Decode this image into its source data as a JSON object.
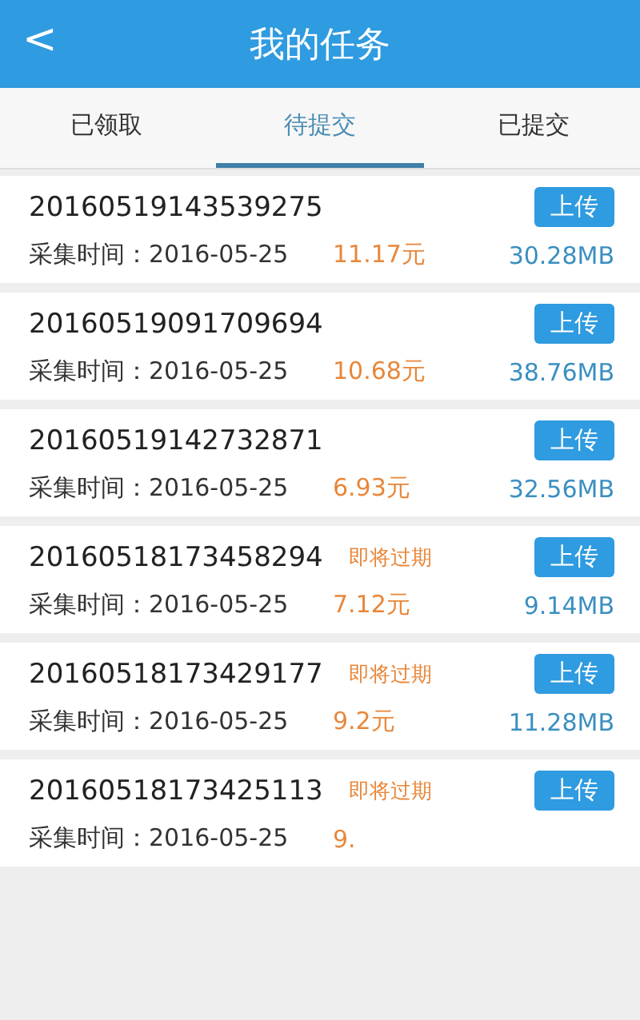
{
  "header": {
    "back": "<",
    "title": "我的任务"
  },
  "tabs": [
    {
      "label": "已领取",
      "selected": false
    },
    {
      "label": "待提交",
      "selected": true
    },
    {
      "label": "已提交",
      "selected": false
    }
  ],
  "tasks": [
    {
      "id": "20160519143539275",
      "label": "采集时间：",
      "date": "2016-05-25",
      "price": "11.17元",
      "size": "30.28MB",
      "button": "上传"
    },
    {
      "id": "20160519091709694",
      "label": "采集时间：",
      "date": "2016-05-25",
      "price": "10.68元",
      "size": "38.76MB",
      "button": "上传"
    },
    {
      "id": "20160519142732871",
      "label": "采集时间：",
      "date": "2016-05-25",
      "price": "6.93元",
      "size": "32.56MB",
      "button": "上传"
    },
    {
      "id": "20160518173458294",
      "warning": "即将过期",
      "label": "采集时间：",
      "date": "2016-05-25",
      "price": "7.12元",
      "size": "9.14MB",
      "button": "上传"
    },
    {
      "id": "20160518173429177",
      "warning": "即将过期",
      "label": "采集时间：",
      "date": "2016-05-25",
      "price": "9.2元",
      "size": "11.28MB",
      "button": "上传"
    },
    {
      "id": "20160518173425113",
      "warning": "即将过期",
      "label": "采集时间：",
      "date": "2016-05-25",
      "price": "9.",
      "button": "上传"
    }
  ]
}
